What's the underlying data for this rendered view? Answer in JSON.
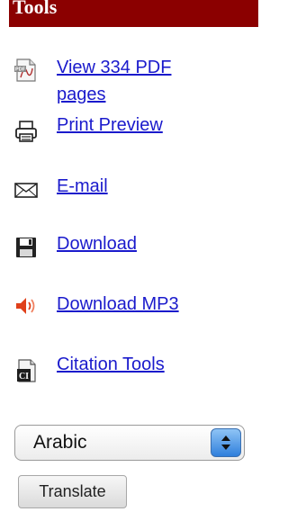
{
  "header": {
    "title": "Tools"
  },
  "tools": [
    {
      "label": "View 334 PDF pages",
      "icon": "pdf-icon"
    },
    {
      "label": "Print Preview",
      "icon": "printer-icon"
    },
    {
      "label": "E-mail",
      "icon": "envelope-icon"
    },
    {
      "label": "Download",
      "icon": "floppy-disk-icon"
    },
    {
      "label": "Download MP3",
      "icon": "speaker-icon"
    },
    {
      "label": "Citation Tools",
      "icon": "citation-icon"
    }
  ],
  "language_select": {
    "selected": "Arabic"
  },
  "translate_button": {
    "label": "Translate"
  },
  "colors": {
    "header_bg": "#8b0000",
    "link": "#1a1acc",
    "speaker": "#e0401a"
  }
}
